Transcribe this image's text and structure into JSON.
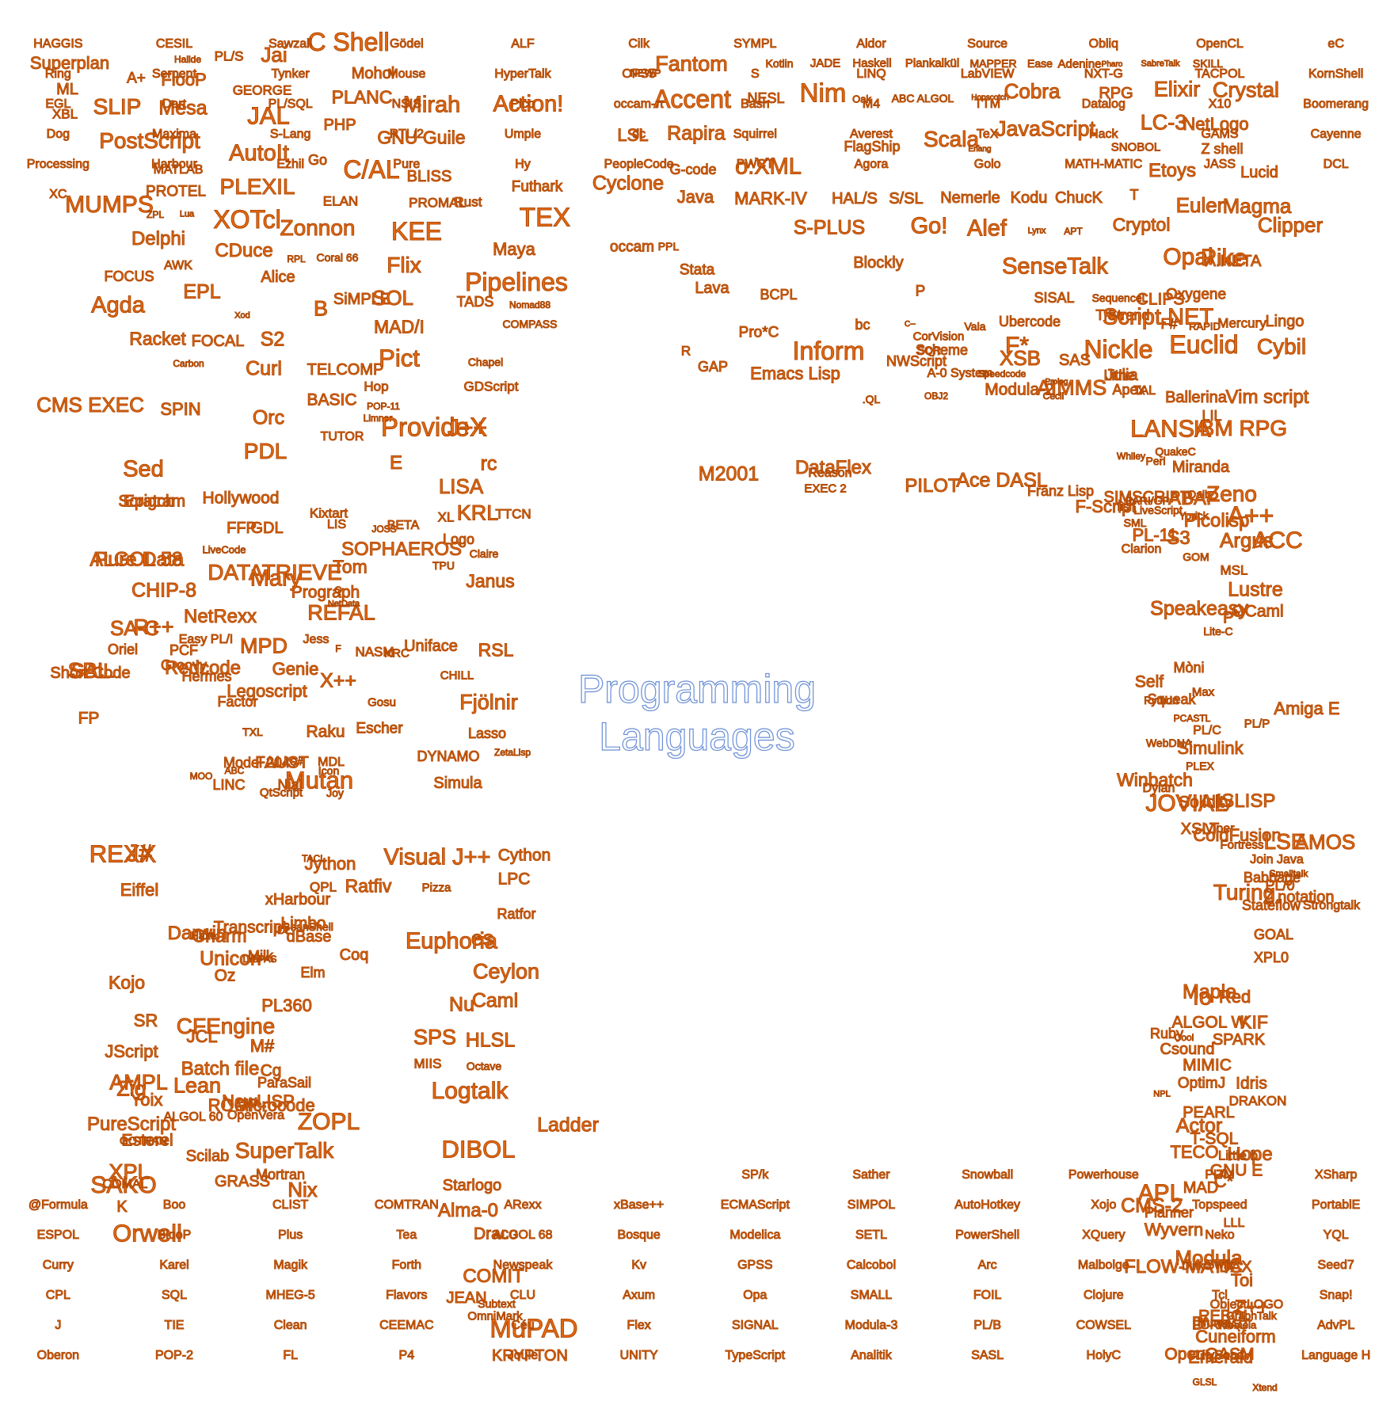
{
  "title_lines": [
    "Programming",
    "Languages"
  ],
  "colors": {
    "word": "#e86a12",
    "word_stroke": "#b04a05",
    "title_stroke": "#6b8fd6"
  },
  "words": [
    "C Shell",
    "Jai",
    "PL/S",
    "Halide",
    "Superplan",
    "A+",
    "FlooP",
    "Mohol",
    "GEORGE",
    "ML",
    "XBL",
    "SLIP",
    "Mesa",
    "JAL",
    "PLANC",
    "PHP",
    "Mirah",
    "Action!",
    "PostScript",
    "GNU Guile",
    "AutoIt",
    "Go",
    "C/AL",
    "MATLAB",
    "BLISS",
    "PROTEL",
    "PLEXIL",
    "Futhark",
    "MUMPS",
    "ZPL",
    "Lua",
    "XOTcl",
    "ELAN",
    "PROMAL",
    "Rust",
    "TEX",
    "Delphi",
    "Zonnon",
    "KEE",
    "Maya",
    "CDuce",
    "RPL",
    "Coral 66",
    "Flix",
    "FOCUS",
    "AWK",
    "Alice",
    "Pipelines",
    "EPL",
    "Agda",
    "SiMPLE",
    "SOL",
    "TADS",
    "B",
    "Xod",
    "Nomad88",
    "MAD/I",
    "COMPASS",
    "Racket",
    "FOCAL",
    "S2",
    "Carbon",
    "Curl",
    "TELCOMP",
    "Pict",
    "Chapel",
    "Hop",
    "GDScript",
    "BASIC",
    "CMS EXEC",
    "SPIN",
    "POP-11",
    "Orc",
    "Limnor",
    "TUTOR",
    "ProvideX",
    "J++",
    "PDL",
    "Sed",
    "E",
    "rc",
    "Scratch",
    "Hollywood",
    "LISA",
    "FFP",
    "Epigram",
    "XL",
    "LIS",
    "KRL",
    "TTCN",
    "LiveCode",
    "Kixtart",
    "ALGOL 58",
    "GDL",
    "Logo",
    "JOSS",
    "SOPHAEROS",
    "Claire",
    "Janus",
    "Pure Data",
    "DATATRIEVE",
    "Prograph",
    "BETA",
    "CHIP-8",
    "Mary",
    "Tom",
    "Q",
    "SA-C",
    "TPU",
    "NetRexx",
    "REFAL",
    "Uniface",
    "R++",
    "MPD",
    "Easy PL/I",
    "Jess",
    "NetData",
    "NASM",
    "CHILL",
    "RSL",
    "Oriel",
    "PCF",
    "F",
    "KRC",
    "SBL",
    "Groovy",
    "X++",
    "Short Code",
    "Hermes",
    "Redcode",
    "Gosu",
    "Factor",
    "Genie",
    "SAIL",
    "Legoscript",
    "Escher",
    "TXL",
    "FP",
    "Raku",
    "Joy",
    "QtScript",
    "ABC",
    "MOO",
    "Model 204",
    "Q#",
    "MDL",
    "Mutan",
    "Icon",
    "Nial",
    "LINC",
    "FAUST",
    "REXX",
    "Jython",
    "TACL",
    "Eiffel",
    "QPL",
    "xHarbour",
    "Charm",
    "Darwin",
    "BeanShell",
    "J#",
    "Ratfiv",
    "Coq",
    "Limbo",
    "IDL",
    "Unicon",
    "Transcript",
    "Haxe",
    "Milk",
    "Elm",
    "Kojo",
    "LYaPAS",
    "Oz",
    "SR",
    "dBase",
    "JScript",
    "PL360",
    "CFEngine",
    "M#",
    "AMPL",
    "Lean",
    "Batch file",
    "Zig",
    "Cg",
    "ParaSail",
    "JCL",
    "PureScript",
    "ROOP",
    "Microcode",
    "ALGOL 60",
    "Esterel",
    "ZOPL",
    "GOTRAN",
    "Yoix",
    "OpenVera",
    "NewLISP",
    "SuperTalk",
    "SAKO",
    "Mortran",
    "Scilab",
    "GRASS",
    "XPL",
    "Nix",
    "COMAL",
    "K",
    "Orwell",
    "Fjölnir",
    "Lasso",
    "ZetaLisp",
    "DYNAMO",
    "Simula",
    "es",
    "Euphoria",
    "Ceylon",
    "Nu",
    "Caml",
    "SPS",
    "HLSL",
    "MIIS",
    "Octave",
    "Logtalk",
    "Visual J++",
    "Pizza",
    "Cython",
    "LPC",
    "Ratfor",
    "Alma-0",
    "Draco",
    "COMIT",
    "JEAN",
    "OmniMark",
    "Subtext",
    "MuPAD",
    "KRYPTON",
    "Starlogo",
    "DIBOL",
    "Ladder",
    "NEWP",
    "Fantom",
    "Kotlin",
    "JADE",
    "Haskell",
    "Plankalkül",
    "MAPPER",
    "Ease",
    "Adenine",
    "Pharo",
    "SabreTalk",
    "SKILL",
    "Accent",
    "NESL",
    "Nim",
    "Oak",
    "ABC ALGOL",
    "Hopscotch",
    "Cobra",
    "RPG",
    "Elixir",
    "Crystal",
    "LSL",
    "Rapira",
    "FlagShip",
    "Scala",
    "JavaScript",
    "Erlang",
    "LC-3",
    "NetLogo",
    "SNOBOL",
    "Z shell",
    "G-code",
    "o:XML",
    "Etoys",
    "Lucid",
    "Cyclone",
    "Java",
    "MARK-IV",
    "HAL/S",
    "S/SL",
    "Nemerle",
    "Kodu",
    "ChucK",
    "T",
    "Euler",
    "Magma",
    "occam",
    "PPL",
    "S-PLUS",
    "Go!",
    "Alef",
    "Lynx",
    "APT",
    "Cryptol",
    "A.NETA",
    "Clipper",
    "Stata",
    "Blockly",
    "SenseTalk",
    "Opal",
    "Pike",
    "Lava",
    "BCPL",
    "P",
    "SISAL",
    "CLIPS",
    "SequenceL",
    "Oxygene",
    "RAPID",
    "F#",
    "Strand",
    "Trac",
    "Nickle",
    "Script.NET",
    "Mercury",
    "Lingo",
    "R",
    "Pro*C",
    "bc",
    "Inform",
    "C--",
    "CorVision",
    "Vala",
    "Ubercode",
    "SAS",
    "Euclid",
    "Cybil",
    "GAP",
    "Emacs Lisp",
    ".QL",
    "NWScript",
    "OBJ2",
    "SQR",
    "Scheme",
    "F*",
    "AIMMS",
    "Ballerina",
    "Vim script",
    "A-0 System",
    "Speedcode",
    "Modula-2",
    "Prolog",
    "XSB",
    "Cecil",
    "Julia",
    "Lithe",
    "Apex",
    "TAL",
    "LIL",
    "LANSA",
    "IBM RPG",
    "QuakeC",
    "Whiley",
    "Perl",
    "Miranda",
    "Qalb",
    "ABAP",
    "Zeno",
    "M2001",
    "DataFlex",
    "EXEC 2",
    "Reason",
    "PILOT",
    "Ace DASL",
    "Franz Lisp",
    "fish",
    "F-Script",
    "SIMSCRIPT",
    "PARI/GP",
    "LiveScript",
    "A++",
    "ACC",
    "SML",
    "Yorick",
    "PL-11",
    "S3",
    "Clarion",
    "Picolisp",
    "GOM",
    "Argus",
    "MSL",
    "Speakeasy",
    "P′′",
    "Lite-C",
    "Lustre",
    "OCaml",
    "Mòni",
    "Self",
    "Max",
    "Python",
    "Squeak",
    "PCASTL",
    "PL/C",
    "PL/P",
    "Amiga E",
    "WebDNA",
    "Simulink",
    "PLEX",
    "Winbatch",
    "JOVIAL",
    "ISLISP",
    "Solidity",
    "Viper",
    "Dylan",
    "XSLT",
    "ColdFusion",
    "Fortress",
    "LSE",
    "AMOS",
    "Join Java",
    "Babbage",
    "Smalltalk",
    "Turing",
    "PL/0",
    "Z notation",
    "Stateflow",
    "Strongtalk",
    "GOAL",
    "XPL0",
    "Maple",
    "Io",
    "Red",
    "ALGOL W",
    "KIF",
    "Cool",
    "Ruby",
    "SPARK",
    "Csound",
    "MIMIC",
    "OptimJ",
    "NPL",
    "Idris",
    "DRAKON",
    "PEARL",
    "Actor",
    "T-SQL",
    "Hope",
    "TECO",
    "Little b",
    "GNU E",
    "C*",
    "MAD",
    "APL",
    "CMS-2",
    "Planner",
    "Wyvern",
    "LLL",
    "Modula",
    "FLOW-MATIC",
    "DAX",
    "DinkC",
    "Toi",
    "ObjectLOGO",
    "Z++",
    "D",
    "Hume",
    "Promela",
    "GraphTalk",
    "Cuneiform",
    "REBOL",
    "Emerald",
    "OpenQASM",
    "GLSL",
    "Xtend",
    "SP/k",
    "Sather",
    "Snowball",
    "Powerhouse",
    "PL/M",
    "XSharp",
    "@Formula",
    "Boo",
    "CLIST",
    "COMTRAN",
    "ARexx",
    "xBase++",
    "ECMAScript",
    "SIMPOL",
    "AutoHotkey",
    "Xojo",
    "Topspeed",
    "PortablE",
    "ESPOL",
    "BlooP",
    "Plus",
    "Tea",
    "ALGOL 68",
    "Bosque",
    "Modelica",
    "SETL",
    "PowerShell",
    "XQuery",
    "Neko",
    "YQL",
    "Curry",
    "Karel",
    "Magik",
    "Forth",
    "Newspeak",
    "Kv",
    "GPSS",
    "Calcobol",
    "Arc",
    "Malbolge",
    "Swift",
    "Seed7",
    "CPL",
    "SQL",
    "MHEG-5",
    "Flavors",
    "CLU",
    "Axum",
    "Opa",
    "SMALL",
    "FOIL",
    "Clojure",
    "Tcl",
    "Snap!",
    "J",
    "TIE",
    "Clean",
    "CEEMAC",
    "Céu",
    "Flex",
    "SIGNAL",
    "Modula-3",
    "PL/B",
    "COWSEL",
    "FORMAC",
    "AdvPL",
    "Oberon",
    "POP-2",
    "FL",
    "P4",
    "Joule",
    "UNITY",
    "TypeScript",
    "Analitik",
    "SASL",
    "HolyC",
    "LilyPond",
    "Language H",
    "HAGGIS",
    "CESIL",
    "Sawzall",
    "Gödel",
    "ALF",
    "Cilk",
    "SYMPL",
    "Aldor",
    "Source",
    "Obliq",
    "OpenCL",
    "eC",
    "Ring",
    "Serpent",
    "Tynker",
    "Mouse",
    "HyperTalk",
    "OPS5",
    "S",
    "LINQ",
    "LabVIEW",
    "NXT-G",
    "TACPOL",
    "KornShell",
    "EGL",
    "Dart",
    "PL/SQL",
    "NSIS",
    "Pico",
    "occam-π",
    "Bash",
    "M4",
    "TTM",
    "Datalog",
    "X10",
    "Boomerang",
    "Dog",
    "Maxima",
    "S-Lang",
    "RTL/2",
    "Umple",
    "dc",
    "Squirrel",
    "Averest",
    "TeX",
    "Hack",
    "GAMS",
    "Cayenne",
    "Processing",
    "Harbour",
    "Ezhil",
    "Pure",
    "Hy",
    "PeopleCode",
    "PWCT",
    "Agora",
    "Golo",
    "MATH-MATIC",
    "JASS",
    "DCL",
    "XC"
  ]
}
